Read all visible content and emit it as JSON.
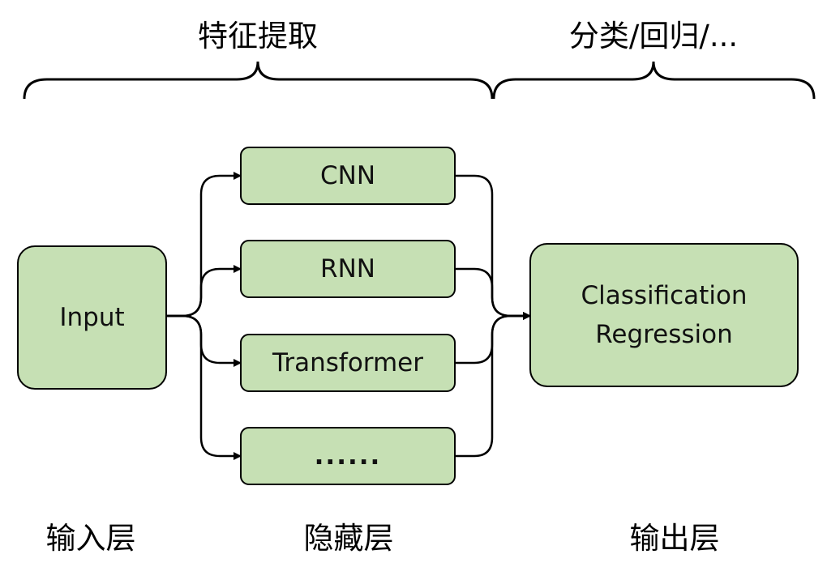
{
  "sections": {
    "feature_extraction": "特征提取",
    "task_head": "分类/回归/..."
  },
  "nodes": {
    "input": "Input",
    "hidden": [
      "CNN",
      "RNN",
      "Transformer",
      "......"
    ],
    "output": {
      "line1": "Classification",
      "line2": "Regression"
    }
  },
  "layers": {
    "input_layer": "输入层",
    "hidden_layer": "隐藏层",
    "output_layer": "输出层"
  },
  "colors": {
    "box_fill": "#c6e0b4",
    "stroke": "#000000"
  }
}
